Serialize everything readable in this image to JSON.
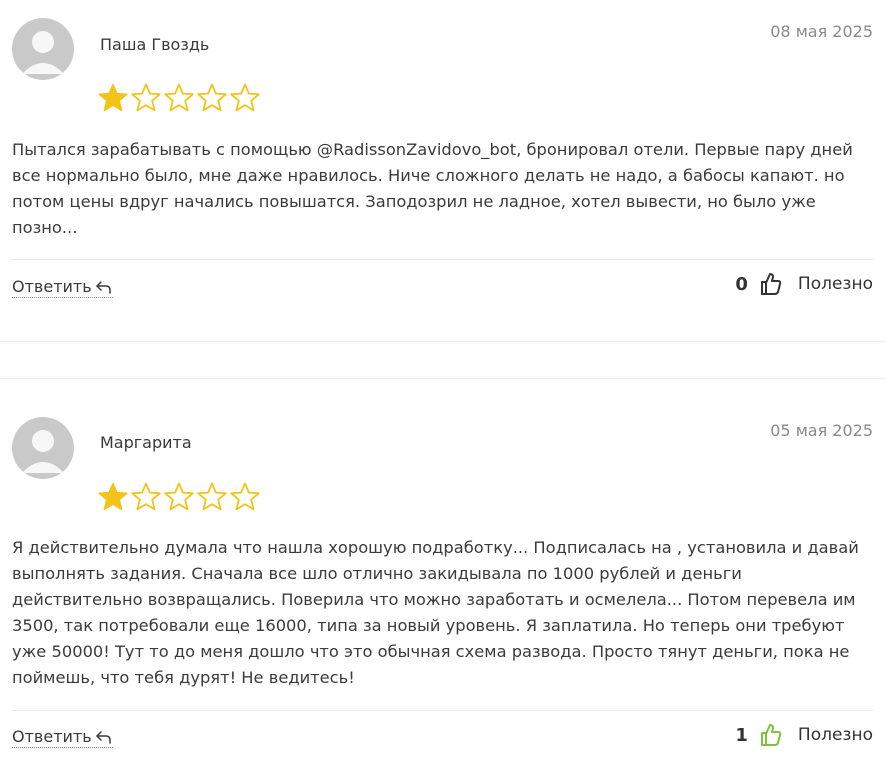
{
  "reviews": [
    {
      "author": "Паша Гвоздь",
      "date": "08 мая 2025",
      "rating": 1,
      "max_rating": 5,
      "text": "Пытался зарабатывать с помощью @RadissonZavidovo_bot, бронировал отели. Первые пару дней все нормально было, мне даже нравилось. Ниче сложного делать не надо, а бабосы капают. но потом цены вдруг начались повышатся. Заподозрил не ладное, хотел вывести, но было уже позно...",
      "reply_label": "Ответить",
      "useful_count": "0",
      "useful_label": "Полезно",
      "thumb_color": "#333333"
    },
    {
      "author": "Маргарита",
      "date": "05 мая 2025",
      "rating": 1,
      "max_rating": 5,
      "text": "Я действительно думала что нашла хорошую подработку... Подписалась на , установила и давай выполнять задания. Сначала все шло отлично закидывала по 1000 рублей и деньги действительно возвращались. Поверила что можно заработать и осмелела... Потом перевела им 3500, так потребовали еще 16000, типа за новый уровень. Я заплатила. Но теперь они требуют уже 50000! Тут то до меня дошло что это обычная схема развода. Просто тянут деньги, пока не поймешь, что тебя дурят! Не ведитесь!",
      "reply_label": "Ответить",
      "useful_count": "1",
      "useful_label": "Полезно",
      "thumb_color": "#7cc23a"
    }
  ],
  "colors": {
    "star_filled": "#f2c319",
    "star_empty_stroke": "#f2c319",
    "avatar_bg": "#c9c9c9"
  },
  "icons": {
    "avatar": "user-silhouette-icon",
    "star": "star-icon",
    "reply": "reply-arrow-icon",
    "thumb": "thumbs-up-icon"
  }
}
